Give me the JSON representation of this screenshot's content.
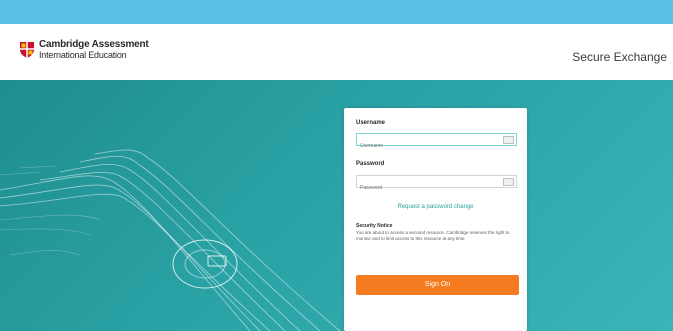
{
  "header": {
    "logo_line1": "Cambridge Assessment",
    "logo_line2": "International Education",
    "app_title": "Secure Exchange"
  },
  "login": {
    "username_label": "Username",
    "username_placeholder": "Username",
    "password_label": "Password",
    "password_placeholder": "Password",
    "password_change_link": "Request a password change",
    "security_notice_title": "Security Notice",
    "security_notice_text": "You are about to access a secured resource. Cambridge reserves the right to monitor and to limit access to this resource at any time.",
    "signin_label": "Sign On"
  },
  "colors": {
    "top_bar": "#5bc1e4",
    "hero_background": "#2aa2a5",
    "signin_button": "#f47b20",
    "link": "#2aa29c"
  },
  "icons": {
    "logo": "shield-icon",
    "username_field": "keyboard-icon",
    "password_field": "keyboard-icon"
  }
}
